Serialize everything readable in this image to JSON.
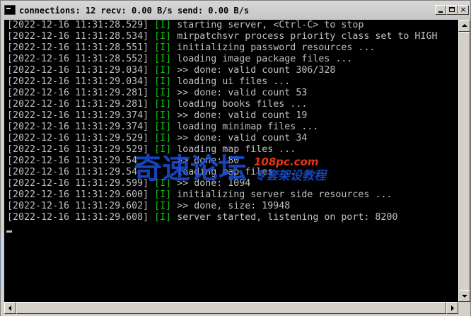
{
  "window": {
    "title": "connections: 12 recv: 0.00 B/s send: 0.00 B/s",
    "icon": "console-icon",
    "buttons": {
      "minimize": "minimize-icon",
      "maximize": "maximize-icon",
      "close": "×"
    }
  },
  "console": {
    "background": "#000000",
    "text_color": "#c0c0c0",
    "level_color": "#0cc40c",
    "lines": [
      {
        "ts": "[2022-12-16 11:31:28.529]",
        "lvl": "[I]",
        "msg": "starting server, <Ctrl-C> to stop"
      },
      {
        "ts": "[2022-12-16 11:31:28.534]",
        "lvl": "[I]",
        "msg": "mirpatchsvr process priority class set to HIGH"
      },
      {
        "ts": "[2022-12-16 11:31:28.551]",
        "lvl": "[I]",
        "msg": "initializing password resources ..."
      },
      {
        "ts": "[2022-12-16 11:31:28.552]",
        "lvl": "[I]",
        "msg": "loading image package files ..."
      },
      {
        "ts": "[2022-12-16 11:31:29.034]",
        "lvl": "[I]",
        "msg": ">> done: valid count 306/328"
      },
      {
        "ts": "[2022-12-16 11:31:29.034]",
        "lvl": "[I]",
        "msg": "loading ui files ..."
      },
      {
        "ts": "[2022-12-16 11:31:29.281]",
        "lvl": "[I]",
        "msg": ">> done: valid count 53"
      },
      {
        "ts": "[2022-12-16 11:31:29.281]",
        "lvl": "[I]",
        "msg": "loading books files ..."
      },
      {
        "ts": "[2022-12-16 11:31:29.374]",
        "lvl": "[I]",
        "msg": ">> done: valid count 19"
      },
      {
        "ts": "[2022-12-16 11:31:29.374]",
        "lvl": "[I]",
        "msg": "loading minimap files ..."
      },
      {
        "ts": "[2022-12-16 11:31:29.529]",
        "lvl": "[I]",
        "msg": ">> done: valid count 34"
      },
      {
        "ts": "[2022-12-16 11:31:29.529]",
        "lvl": "[I]",
        "msg": "loading map files ..."
      },
      {
        "ts": "[2022-12-16 11:31:29.54",
        "lvl": "",
        "msg": "     >> done: 80"
      },
      {
        "ts": "[2022-12-16 11:31:29.54",
        "lvl": "",
        "msg": "     loading map files ..."
      },
      {
        "ts": "[2022-12-16 11:31:29.599]",
        "lvl": "[I]",
        "msg": ">> done: 1094"
      },
      {
        "ts": "[2022-12-16 11:31:29.600]",
        "lvl": "[I]",
        "msg": "initializing server side resources ..."
      },
      {
        "ts": "[2022-12-16 11:31:29.602]",
        "lvl": "[I]",
        "msg": ">> done, size: 19948"
      },
      {
        "ts": "[2022-12-16 11:31:29.608]",
        "lvl": "[I]",
        "msg": "server started, listening on port: 8200"
      }
    ]
  },
  "watermark": {
    "main": "奇速论坛",
    "site": "108pc.com",
    "tagline": "专套架设教程",
    "color_main": "#1a4fd8",
    "color_accent": "#ff3a1a"
  },
  "scrollbars": {
    "vertical": "vertical-scrollbar",
    "horizontal": "horizontal-scrollbar"
  }
}
